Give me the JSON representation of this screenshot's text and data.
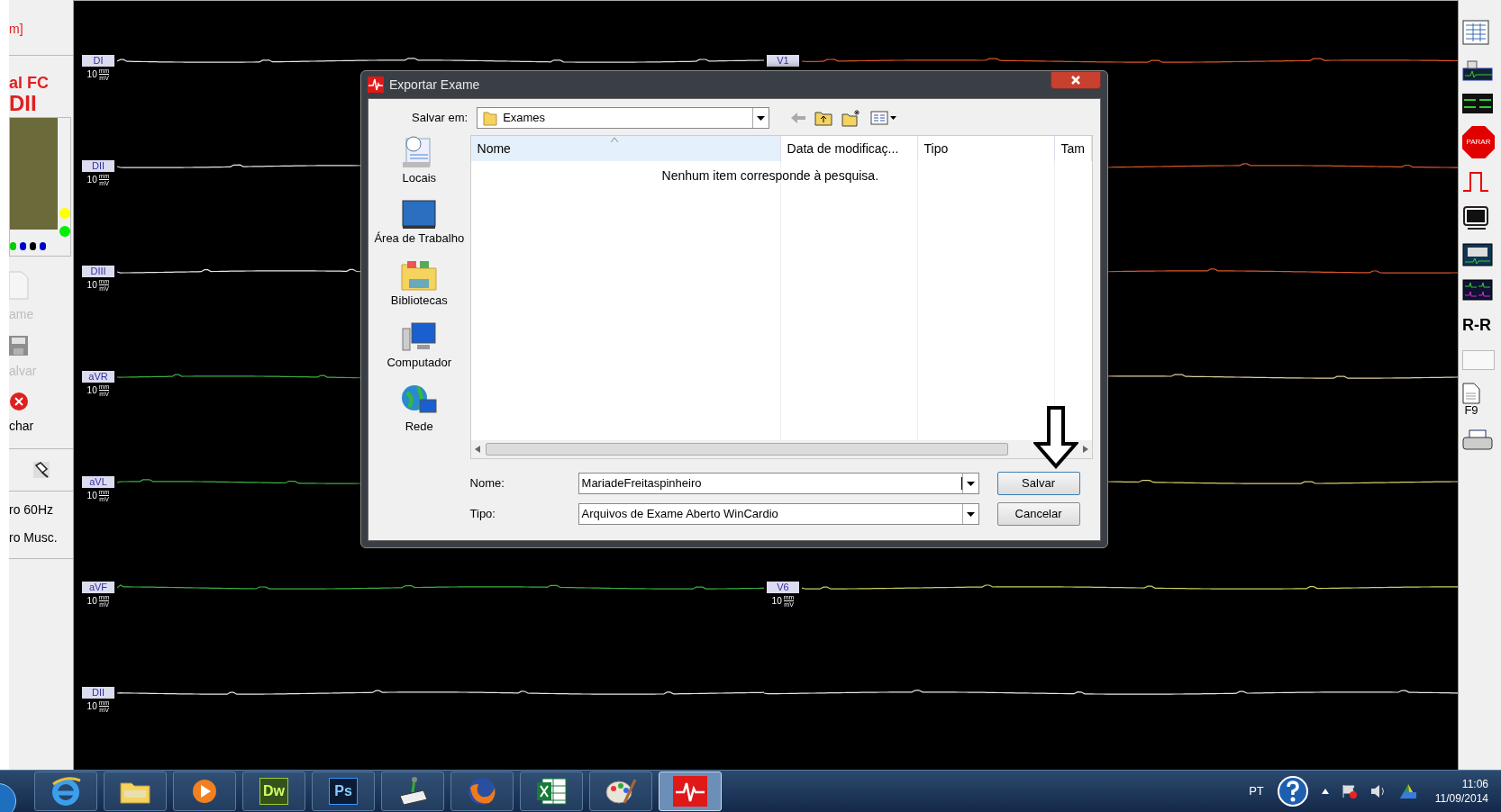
{
  "left_panel": {
    "header": "m]",
    "title": "al FC",
    "lead": "DII",
    "indicator_dots": [
      {
        "color": "#ffff00"
      },
      {
        "color": "#00ee00"
      }
    ],
    "electrode_dots": [
      {
        "color": "#00cc00"
      },
      {
        "color": "#0000cc"
      },
      {
        "color": "#000000"
      },
      {
        "color": "#0000cc"
      }
    ],
    "actions": [
      {
        "kind": "new",
        "label": "ame",
        "disabled": true
      },
      {
        "kind": "save",
        "label": "alvar",
        "disabled": true
      },
      {
        "kind": "close",
        "label": "char",
        "disabled": false
      }
    ],
    "filters": [
      "ro 60Hz",
      "ro Musc."
    ]
  },
  "leads": [
    {
      "label": "DI",
      "scale": "10",
      "unit_top": "mm",
      "unit_bottom": "mV",
      "color": "#e8e8e8",
      "right": {
        "label": "V1",
        "color": "#d9572b"
      }
    },
    {
      "label": "DII",
      "scale": "10",
      "unit_top": "mm",
      "unit_bottom": "mV",
      "color": "#e8e8e8",
      "right": {
        "color": "#d9572b"
      }
    },
    {
      "label": "DIII",
      "scale": "10",
      "unit_top": "mm",
      "unit_bottom": "mV",
      "color": "#e8e8e8",
      "right": {
        "color": "#d9572b"
      }
    },
    {
      "label": "aVR",
      "scale": "10",
      "unit_top": "mm",
      "unit_bottom": "mV",
      "color": "#3cb043",
      "right": {
        "color": "#e0d0a0"
      }
    },
    {
      "label": "aVL",
      "scale": "10",
      "unit_top": "mm",
      "unit_bottom": "mV",
      "color": "#3cb043",
      "right": {
        "color": "#d8d070"
      }
    },
    {
      "label": "aVF",
      "scale": "10",
      "unit_top": "mm",
      "unit_bottom": "mV",
      "color": "#3cb043",
      "right": {
        "label": "V6",
        "scale": "10",
        "unit_top": "mm",
        "unit_bottom": "mV",
        "color": "#c8d060"
      }
    },
    {
      "label": "DII",
      "scale": "10",
      "unit_top": "mm",
      "unit_bottom": "mV",
      "color": "#e8e8e8",
      "right": {
        "color": "#e8e8e8"
      }
    }
  ],
  "toolbar": [
    {
      "kind": "report"
    },
    {
      "kind": "monitor-ecg"
    },
    {
      "kind": "lines"
    },
    {
      "kind": "stop",
      "label": "PARAR"
    },
    {
      "kind": "pulse"
    },
    {
      "kind": "screen"
    },
    {
      "kind": "window-ecg"
    },
    {
      "kind": "grid-ecg"
    },
    {
      "kind": "text",
      "label": "R-R"
    },
    {
      "kind": "blank"
    },
    {
      "kind": "document",
      "label": "F9"
    },
    {
      "kind": "printer"
    }
  ],
  "dialog": {
    "title": "Exportar Exame",
    "save_in_label": "Salvar em:",
    "save_in_value": "Exames",
    "places": [
      {
        "kind": "recent",
        "label": "Locais"
      },
      {
        "kind": "desktop",
        "label": "Área de Trabalho"
      },
      {
        "kind": "libraries",
        "label": "Bibliotecas"
      },
      {
        "kind": "computer",
        "label": "Computador"
      },
      {
        "kind": "network",
        "label": "Rede"
      }
    ],
    "columns": [
      {
        "label": "Nome",
        "sorted": true
      },
      {
        "label": "Data de modificaç...",
        "sorted": false
      },
      {
        "label": "Tipo",
        "sorted": false
      },
      {
        "label": "Tam",
        "sorted": false
      }
    ],
    "empty_message": "Nenhum item corresponde à pesquisa.",
    "name_label": "Nome:",
    "name_value": "MariadeFreitaspinheiro",
    "type_label": "Tipo:",
    "type_value": "Arquivos de Exame Aberto WinCardio",
    "buttons": [
      "Salvar",
      "Cancelar"
    ]
  },
  "taskbar": {
    "apps": [
      {
        "kind": "ie",
        "selected": false
      },
      {
        "kind": "explorer",
        "selected": false
      },
      {
        "kind": "media",
        "selected": false
      },
      {
        "kind": "dw",
        "label": "Dw",
        "selected": false
      },
      {
        "kind": "ps",
        "label": "Ps",
        "selected": false
      },
      {
        "kind": "scanner",
        "selected": false
      },
      {
        "kind": "firefox",
        "selected": false
      },
      {
        "kind": "excel",
        "selected": false
      },
      {
        "kind": "paint",
        "selected": false
      },
      {
        "kind": "cardio",
        "selected": true
      }
    ],
    "language": "PT",
    "time": "11:06",
    "date": "11/09/2014"
  }
}
